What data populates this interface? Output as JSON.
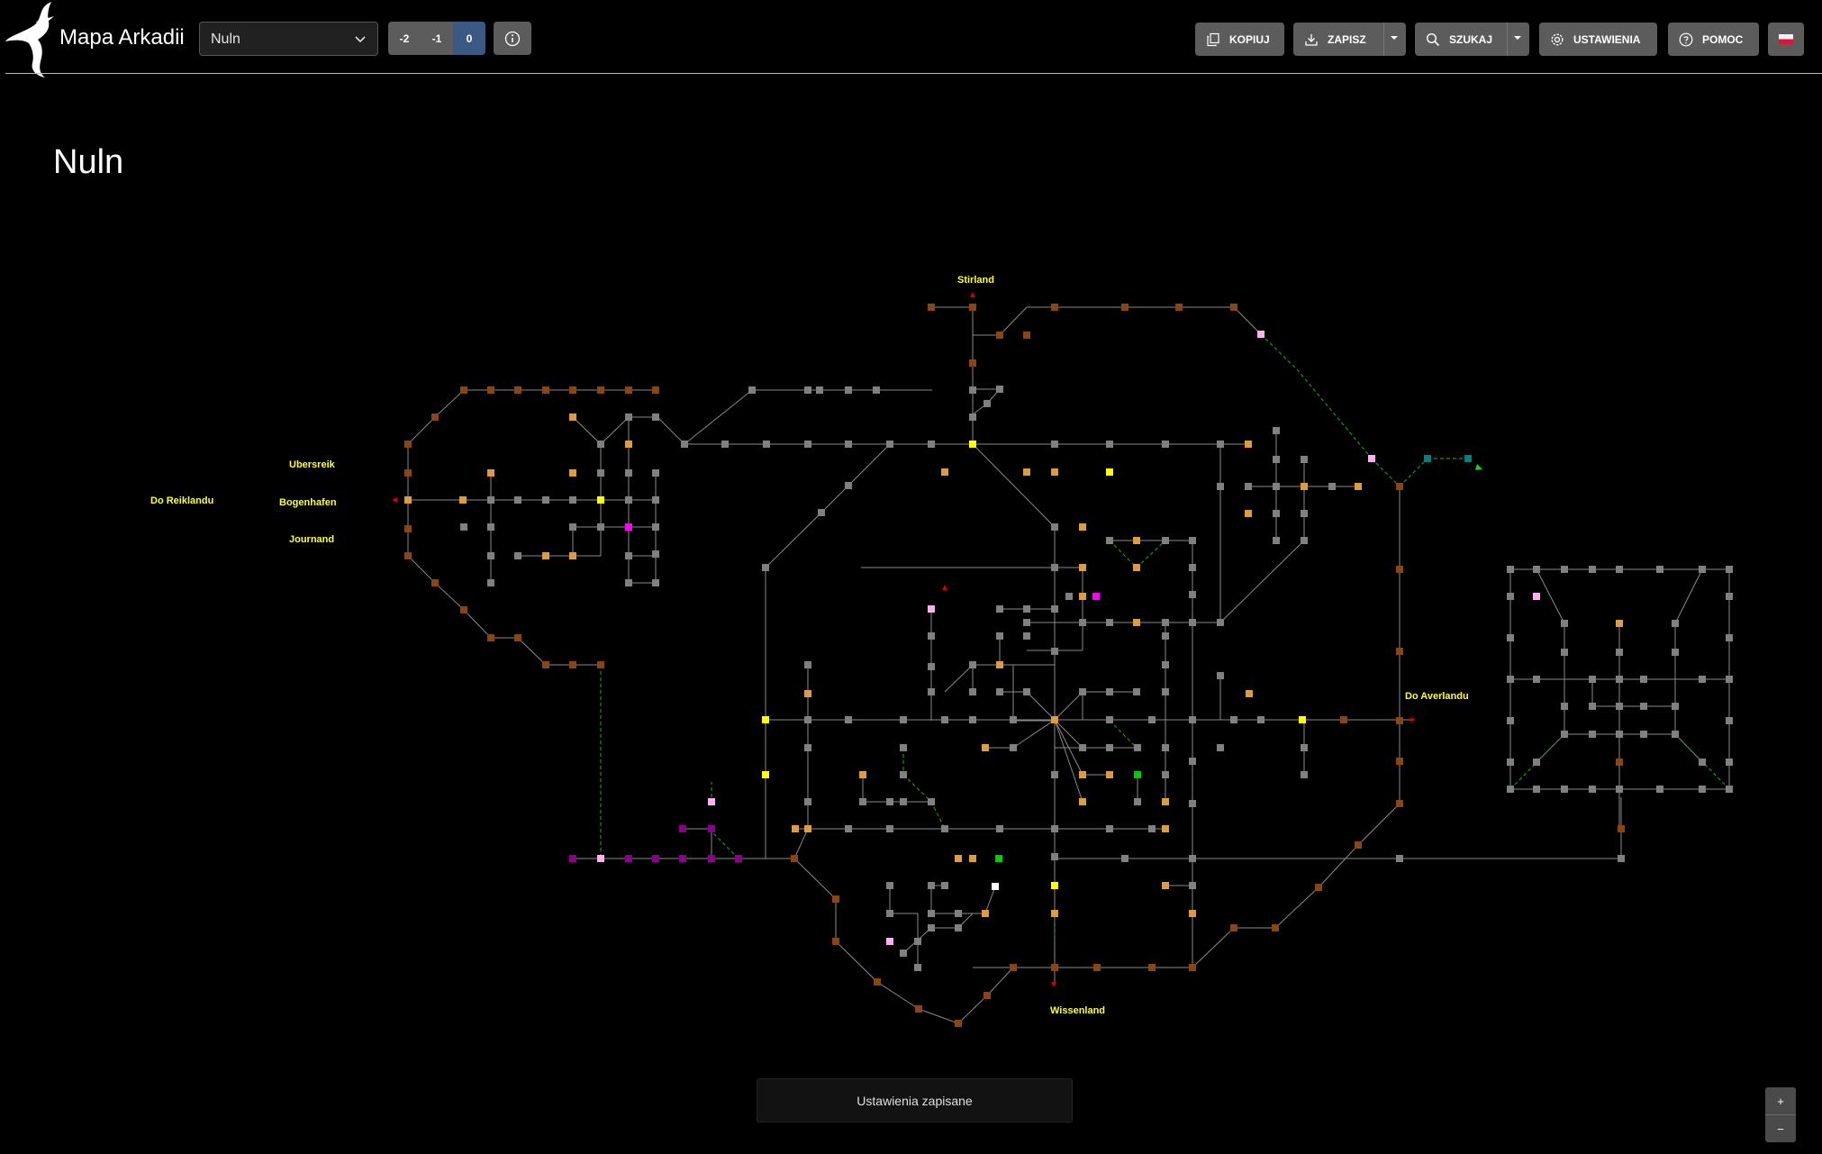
{
  "app": {
    "title": "Mapa Arkadii"
  },
  "location_select": {
    "value": "Nuln"
  },
  "levels": [
    "-2",
    "-1",
    "0"
  ],
  "active_level": "0",
  "toolbar": {
    "copy_label": "KOPIUJ",
    "save_label": "ZAPISZ",
    "search_label": "SZUKAJ",
    "settings_label": "USTAWIENIA",
    "help_label": "POMOC"
  },
  "page": {
    "title": "Nuln"
  },
  "map_labels": {
    "stirland": "Stirland",
    "ubersreik": "Ubersreik",
    "do_reiklandu": "Do Reiklandu",
    "bogenhafen": "Bogenhafen",
    "journand": "Journand",
    "do_averlandu": "Do Averlandu",
    "wissenland": "Wissenland"
  },
  "toast": {
    "message": "Ustawienia zapisane"
  },
  "zoom": {
    "in": "+",
    "out": "−"
  },
  "colors": {
    "background": "#000000",
    "button": "#5c5c5c",
    "active_level": "#3b5a83",
    "label_yellow": "#ffff33",
    "room_gray": "#808080",
    "room_brown": "#8b4513",
    "room_orange": "#e09a40",
    "room_yellow": "#ffff00",
    "room_magenta": "#ff00ff",
    "room_purple": "#8b008b",
    "room_pink": "#ffb0f0",
    "room_green": "#00cc00",
    "room_teal": "#008080",
    "room_white": "#ffffff",
    "exit_red": "#cc0000",
    "link_gray": "#8a8a8a",
    "link_green_dashed": "#1f8f1f"
  },
  "icons": {
    "logo": "dragon-logo",
    "select": "chevron-down-icon",
    "info": "info-icon",
    "copy": "copy-icon",
    "save": "download-icon",
    "search": "search-icon",
    "settings": "gear-icon",
    "help": "help-icon",
    "language": "poland-flag-icon"
  }
}
